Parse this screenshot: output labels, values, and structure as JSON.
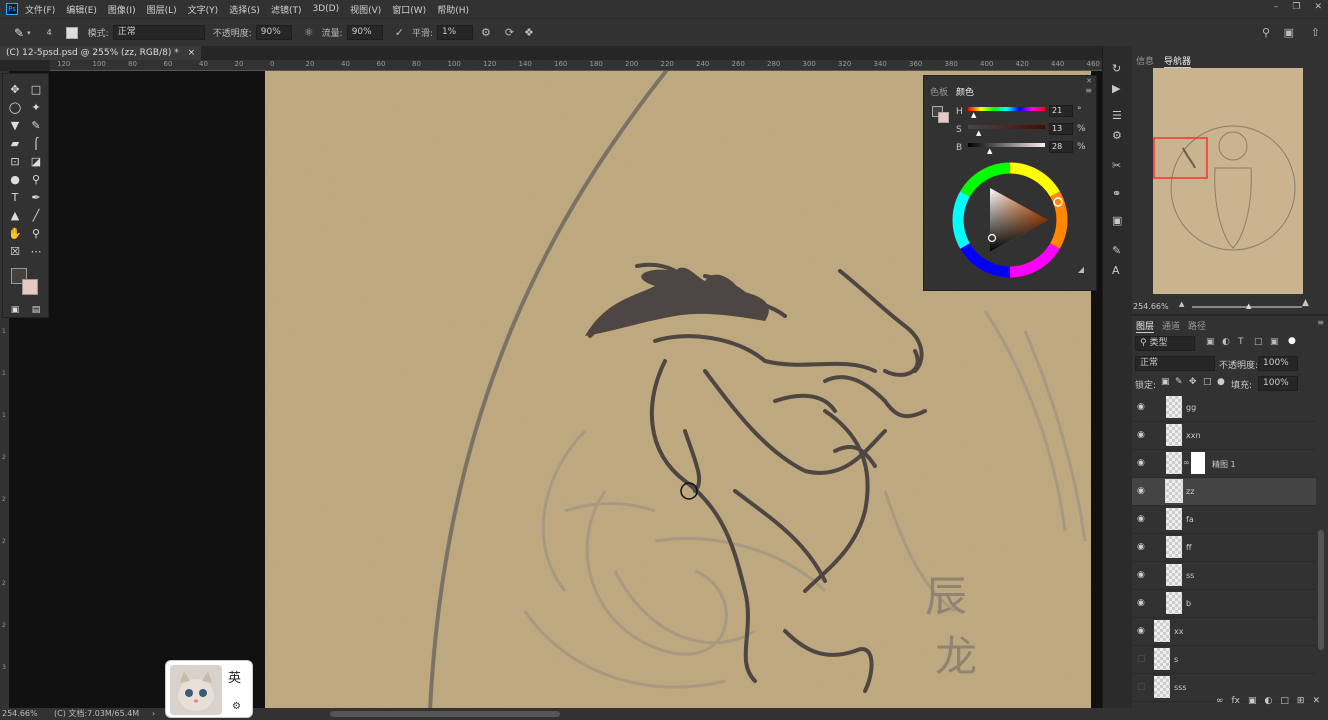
{
  "menubar": {
    "app_icon": "Ps",
    "items": [
      "文件(F)",
      "编辑(E)",
      "图像(I)",
      "图层(L)",
      "文字(Y)",
      "选择(S)",
      "滤镜(T)",
      "3D(D)",
      "视图(V)",
      "窗口(W)",
      "帮助(H)"
    ]
  },
  "options": {
    "brush_size": "4",
    "mode_label": "模式:",
    "mode_value": "正常",
    "opacity_label": "不透明度:",
    "opacity_value": "90%",
    "flow_label": "流量:",
    "flow_value": "90%",
    "smooth_label": "平滑:",
    "smooth_value": "1%"
  },
  "document": {
    "tab_title": "(C) 12-5psd.psd @ 255% (zz, RGB/8) *",
    "close": "×"
  },
  "ruler": {
    "h_ticks": [
      "120",
      "100",
      "80",
      "60",
      "40",
      "20",
      "0",
      "20",
      "40",
      "60",
      "80",
      "100",
      "120",
      "140",
      "160",
      "180",
      "200",
      "220",
      "240",
      "260",
      "280",
      "300",
      "320",
      "340",
      "360",
      "380",
      "400",
      "420",
      "440",
      "460"
    ],
    "v_ticks": [
      "2",
      "4",
      "6",
      "8",
      "1",
      "1",
      "1",
      "1",
      "1",
      "2",
      "2",
      "2",
      "2",
      "2",
      "3"
    ]
  },
  "canvas_text": {
    "char1": "辰",
    "char2": "龙"
  },
  "color_panel": {
    "tab_swatches": "色板",
    "tab_color": "颜色",
    "h_label": "H",
    "h_value": "21",
    "h_unit": "°",
    "s_label": "S",
    "s_value": "13",
    "s_unit": "%",
    "b_label": "B",
    "b_value": "28",
    "b_unit": "%"
  },
  "navigator": {
    "tab_info": "信息",
    "tab_nav": "导航器",
    "zoom": "254.66%"
  },
  "layers": {
    "tab_layers": "图层",
    "tab_channels": "通道",
    "tab_paths": "路径",
    "filter_label": "类型",
    "blend_mode": "正常",
    "opacity_label": "不透明度:",
    "opacity_value": "100%",
    "lock_label": "锁定:",
    "fill_label": "填充:",
    "fill_value": "100%",
    "items": [
      {
        "name": "gg",
        "visible": true
      },
      {
        "name": "xxn",
        "visible": true
      },
      {
        "name": "精图 1",
        "visible": true
      },
      {
        "name": "zz",
        "visible": true
      },
      {
        "name": "fa",
        "visible": true
      },
      {
        "name": "ff",
        "visible": true
      },
      {
        "name": "ss",
        "visible": true
      },
      {
        "name": "b",
        "visible": true
      },
      {
        "name": "xx",
        "visible": true
      },
      {
        "name": "s",
        "visible": false
      },
      {
        "name": "sss",
        "visible": false
      }
    ]
  },
  "status": {
    "zoom": "254.66%",
    "doc_info": "(C) 文档:7.03M/65.4M"
  },
  "ime": {
    "lang": "英"
  },
  "colors": {
    "foreground": "#48403a",
    "background": "#e8c9c0",
    "paper": "#c4ad82"
  }
}
